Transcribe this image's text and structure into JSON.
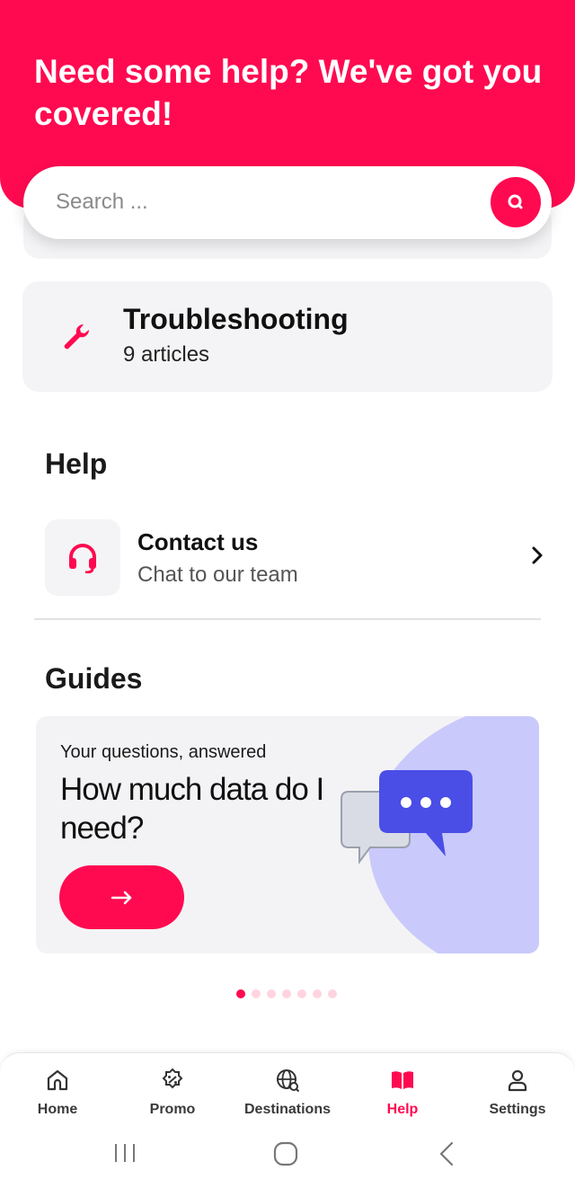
{
  "header": {
    "title": "Need some help? We've got you covered!"
  },
  "search": {
    "placeholder": "Search ...",
    "value": ""
  },
  "troubleshooting": {
    "title": "Troubleshooting",
    "subtitle": "9 articles"
  },
  "help_section": {
    "title": "Help",
    "contact": {
      "title": "Contact us",
      "subtitle": "Chat to our team"
    }
  },
  "guides_section": {
    "title": "Guides",
    "card": {
      "kicker": "Your questions, answered",
      "title": "How much data do I need?"
    },
    "carousel": {
      "total": 7,
      "active": 1
    }
  },
  "bottom_nav": {
    "items": [
      {
        "label": "Home",
        "icon": "home-icon"
      },
      {
        "label": "Promo",
        "icon": "promo-badge-icon"
      },
      {
        "label": "Destinations",
        "icon": "globe-search-icon"
      },
      {
        "label": "Help",
        "icon": "book-icon"
      },
      {
        "label": "Settings",
        "icon": "user-icon"
      }
    ],
    "active": "Help"
  },
  "system_nav": {
    "buttons": [
      "recents-icon",
      "home-circle-icon",
      "back-icon"
    ]
  },
  "colors": {
    "brand": "#ff0a50",
    "card_bg": "#f4f4f6",
    "guide_accent": "#c9c9fb",
    "bubble_blue": "#4a4ee6"
  }
}
